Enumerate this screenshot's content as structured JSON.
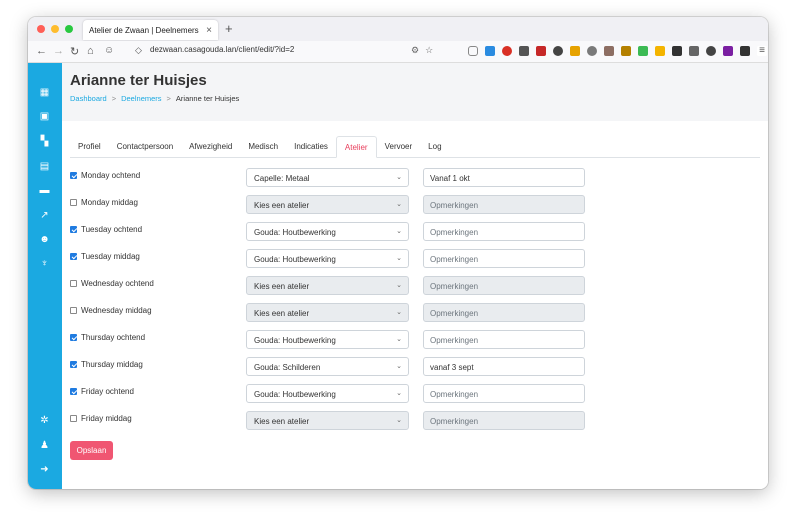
{
  "browser": {
    "tab_title": "Atelier de Zwaan | Deelnemers",
    "tab_close": "×",
    "new_tab": "+",
    "url": "dezwaan.casagouda.lan/client/edit/?id=2"
  },
  "page": {
    "title": "Arianne ter Huisjes",
    "breadcrumb": [
      "Dashboard",
      "Deelnemers",
      "Arianne ter Huisjes"
    ],
    "breadcrumb_sep": ">"
  },
  "tabs": [
    "Profiel",
    "Contactpersoon",
    "Afwezigheid",
    "Medisch",
    "Indicaties",
    "Atelier",
    "Vervoer",
    "Log"
  ],
  "active_tab": "Atelier",
  "schedule": [
    {
      "label": "Monday ochtend",
      "checked": true,
      "atelier": "Capelle: Metaal",
      "note": "Vanaf 1 okt",
      "note_is_placeholder": false
    },
    {
      "label": "Monday middag",
      "checked": false,
      "atelier": "Kies een atelier",
      "note": "Opmerkingen",
      "note_is_placeholder": true
    },
    {
      "label": "Tuesday ochtend",
      "checked": true,
      "atelier": "Gouda: Houtbewerking",
      "note": "Opmerkingen",
      "note_is_placeholder": true
    },
    {
      "label": "Tuesday middag",
      "checked": true,
      "atelier": "Gouda: Houtbewerking",
      "note": "Opmerkingen",
      "note_is_placeholder": true
    },
    {
      "label": "Wednesday ochtend",
      "checked": false,
      "atelier": "Kies een atelier",
      "note": "Opmerkingen",
      "note_is_placeholder": true
    },
    {
      "label": "Wednesday middag",
      "checked": false,
      "atelier": "Kies een atelier",
      "note": "Opmerkingen",
      "note_is_placeholder": true
    },
    {
      "label": "Thursday ochtend",
      "checked": true,
      "atelier": "Gouda: Houtbewerking",
      "note": "Opmerkingen",
      "note_is_placeholder": true
    },
    {
      "label": "Thursday middag",
      "checked": true,
      "atelier": "Gouda: Schilderen",
      "note": "vanaf 3 sept",
      "note_is_placeholder": false
    },
    {
      "label": "Friday ochtend",
      "checked": true,
      "atelier": "Gouda: Houtbewerking",
      "note": "Opmerkingen",
      "note_is_placeholder": true
    },
    {
      "label": "Friday middag",
      "checked": false,
      "atelier": "Kies een atelier",
      "note": "Opmerkingen",
      "note_is_placeholder": true
    }
  ],
  "save_label": "Opslaan",
  "colors": {
    "sidebar": "#1ba9e1",
    "accent": "#e83e5c",
    "save_button": "#f05672",
    "link": "#1ba9e1"
  },
  "sidebar_icons": [
    "dashboard-icon",
    "clients-icon",
    "grid-icon",
    "workshop-icon",
    "bus-icon",
    "chart-icon",
    "users-icon",
    "trophy-icon",
    "settings-icon",
    "account-icon",
    "logout-icon"
  ]
}
